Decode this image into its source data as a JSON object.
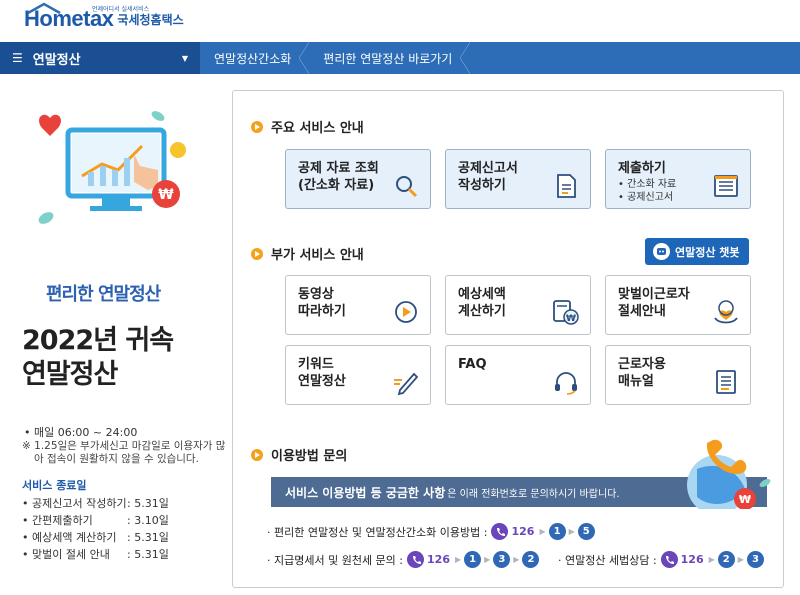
{
  "header": {
    "logo_text": "Hometax",
    "logo_tagline": "언제어디서 실세서비스",
    "logo_kr": "국세청홈택스"
  },
  "nav": {
    "main_label": "연말정산",
    "links": [
      "연말정산간소화",
      "편리한 연말정산 바로가기"
    ]
  },
  "left": {
    "title": "편리한 연말정산",
    "big_title_line1": "2022년 귀속",
    "big_title_line2": "연말정산",
    "hours": "• 매일 06:00 ~ 24:00",
    "notice": "※ 1.25일은 부가세신고 마감일로 이용자가 많아 접속이 원활하지 않을 수 있습니다.",
    "service_end_title": "서비스 종료일",
    "service_end": [
      {
        "name": "• 공제신고서 작성하기",
        "date": ": 5.31일"
      },
      {
        "name": "• 간편제출하기",
        "date": ": 3.10일"
      },
      {
        "name": "• 예상세액 계산하기",
        "date": ": 5.31일"
      },
      {
        "name": "• 맞벌이 절세 안내",
        "date": ": 5.31일"
      }
    ]
  },
  "main_services": {
    "title": "주요 서비스 안내",
    "cards": [
      {
        "label": "공제 자료 조회\n(간소화 자료)",
        "icon": "magnifier-icon"
      },
      {
        "label": "공제신고서\n작성하기",
        "icon": "document-icon"
      },
      {
        "label": "제출하기",
        "sub": [
          "• 간소화 자료",
          "• 공제신고서"
        ],
        "icon": "submit-tray-icon"
      }
    ]
  },
  "extra_services": {
    "title": "부가 서비스 안내",
    "chatbot_label": "연말정산 챗봇",
    "cards": [
      {
        "label": "동영상\n따라하기",
        "icon": "play-icon"
      },
      {
        "label": "예상세액\n계산하기",
        "icon": "calculator-won-icon"
      },
      {
        "label": "맞벌이근로자\n절세안내",
        "icon": "heart-hand-icon"
      },
      {
        "label": "키워드\n연말정산",
        "icon": "pencil-icon"
      },
      {
        "label": "FAQ",
        "icon": "headset-icon"
      },
      {
        "label": "근로자용\n매뉴얼",
        "icon": "manual-icon"
      }
    ]
  },
  "inquiry": {
    "title": "이용방법 문의",
    "banner_bold": "서비스 이용방법 등 궁금한 사항",
    "banner_rest": "은 이래 전화번호로 문의하시기 바랍니다.",
    "row1_label": "· 편리한 연말정산 및 연말정산간소화 이용방법 :",
    "row1_seq": [
      "1",
      "5"
    ],
    "row2_label": "· 지급명세서 및 원천세 문의 :",
    "row2_seq": [
      "1",
      "3",
      "2"
    ],
    "row3_label": "· 연말정산 세법상담 :",
    "row3_seq": [
      "2",
      "3"
    ],
    "phone_number": "126"
  },
  "colors": {
    "nav_blue": "#2d6cb6",
    "nav_dark": "#1b4f94",
    "accent_orange": "#f3a21b",
    "phone_purple": "#6a46b8"
  }
}
